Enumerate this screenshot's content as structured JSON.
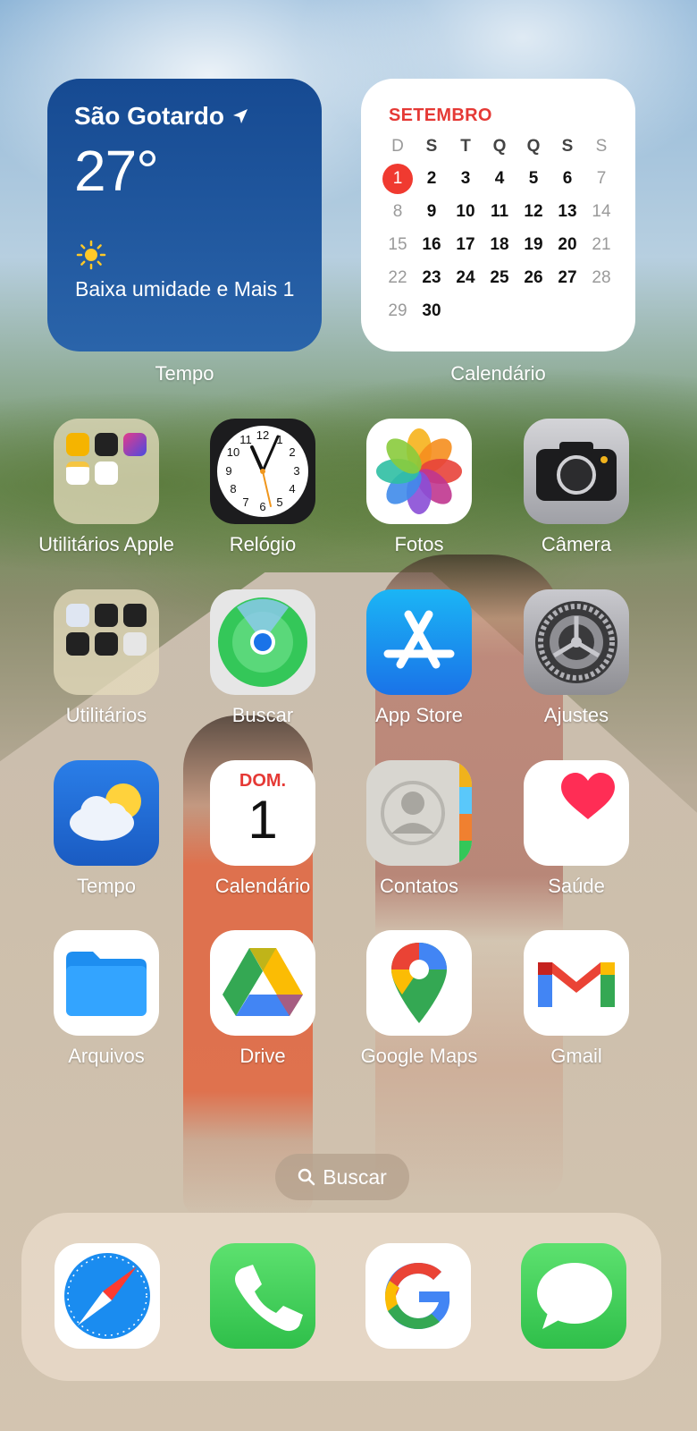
{
  "weather_widget": {
    "city": "São Gotardo",
    "temperature": "27°",
    "condition": "Baixa umidade e Mais 1",
    "label": "Tempo"
  },
  "calendar_widget": {
    "month": "SETEMBRO",
    "weekdays": [
      "D",
      "S",
      "T",
      "Q",
      "Q",
      "S",
      "S"
    ],
    "weeks": [
      [
        "1",
        "2",
        "3",
        "4",
        "5",
        "6",
        "7"
      ],
      [
        "8",
        "9",
        "10",
        "11",
        "12",
        "13",
        "14"
      ],
      [
        "15",
        "16",
        "17",
        "18",
        "19",
        "20",
        "21"
      ],
      [
        "22",
        "23",
        "24",
        "25",
        "26",
        "27",
        "28"
      ],
      [
        "29",
        "30",
        "",
        "",
        "",
        "",
        ""
      ]
    ],
    "today": "1",
    "label": "Calendário"
  },
  "apps": [
    {
      "label": "Utilitários Apple",
      "icon": "folder-icon"
    },
    {
      "label": "Relógio",
      "icon": "clock-icon"
    },
    {
      "label": "Fotos",
      "icon": "photos-icon"
    },
    {
      "label": "Câmera",
      "icon": "camera-icon"
    },
    {
      "label": "Utilitários",
      "icon": "folder-icon"
    },
    {
      "label": "Buscar",
      "icon": "find-my-icon"
    },
    {
      "label": "App Store",
      "icon": "app-store-icon"
    },
    {
      "label": "Ajustes",
      "icon": "settings-gear-icon"
    },
    {
      "label": "Tempo",
      "icon": "weather-icon"
    },
    {
      "label": "Calendário",
      "icon": "calendar-icon"
    },
    {
      "label": "Contatos",
      "icon": "contacts-icon"
    },
    {
      "label": "Saúde",
      "icon": "health-heart-icon"
    },
    {
      "label": "Arquivos",
      "icon": "files-folder-icon"
    },
    {
      "label": "Drive",
      "icon": "google-drive-icon"
    },
    {
      "label": "Google Maps",
      "icon": "google-maps-pin-icon"
    },
    {
      "label": "Gmail",
      "icon": "gmail-icon"
    }
  ],
  "calendar_icon": {
    "weekday": "DOM.",
    "day": "1"
  },
  "search": {
    "label": "Buscar"
  },
  "dock": [
    {
      "name": "Safari",
      "icon": "safari-compass-icon"
    },
    {
      "name": "Phone",
      "icon": "phone-icon"
    },
    {
      "name": "Google",
      "icon": "google-g-icon"
    },
    {
      "name": "Messages",
      "icon": "messages-bubble-icon"
    }
  ],
  "colors": {
    "calendar_red": "#e53935",
    "weather_blue": "#164a92",
    "ios_green": "#34c759"
  }
}
